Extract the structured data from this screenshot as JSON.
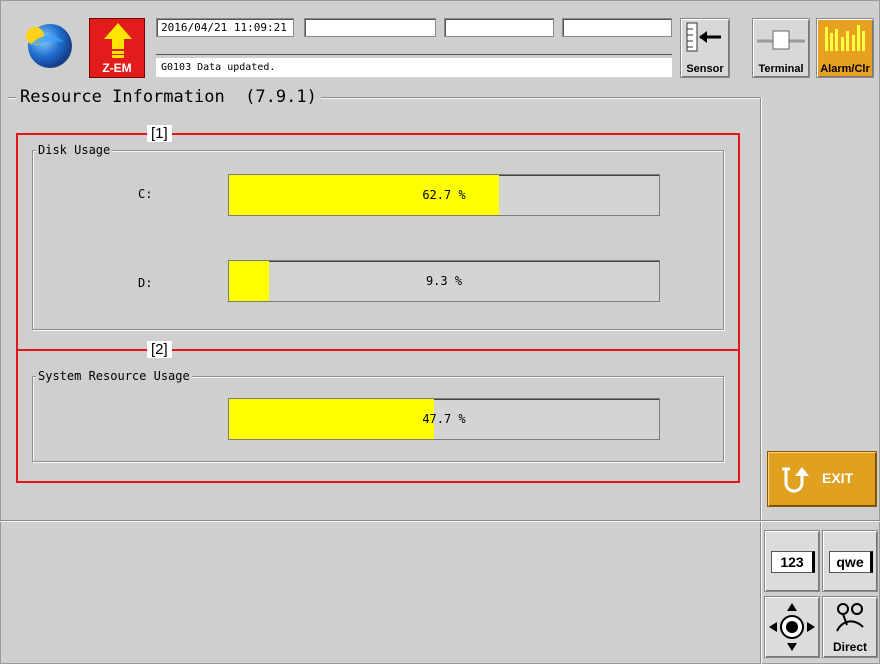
{
  "header": {
    "datetime": "2016/04/21 11:09:21",
    "message": "G0103  Data updated.",
    "status_fields": [
      "",
      "",
      ""
    ],
    "logo_label": "Z-EM",
    "buttons": {
      "sensor": "Sensor",
      "terminal": "Terminal",
      "alarm": "Alarm/Clr"
    }
  },
  "page": {
    "title": "Resource Information  (7.9.1)"
  },
  "disk": {
    "legend": "Disk Usage",
    "callout": "[1]",
    "drives": [
      {
        "label": "C:",
        "percent": 62.7,
        "text": "62.7 %"
      },
      {
        "label": "D:",
        "percent": 9.3,
        "text": "9.3 %"
      }
    ]
  },
  "system": {
    "legend": "System Resource Usage",
    "callout": "[2]",
    "percent": 47.7,
    "text": "47.7 %"
  },
  "side": {
    "exit_label": "EXIT"
  },
  "keypad": {
    "numeric_label": "123",
    "alpha_label": "qwe",
    "direct_label": "Direct"
  },
  "colors": {
    "bar_fill": "#ffff00",
    "highlight": "#e01818",
    "exit_bg": "#e0a020",
    "alarm_bg": "#e8a020"
  }
}
